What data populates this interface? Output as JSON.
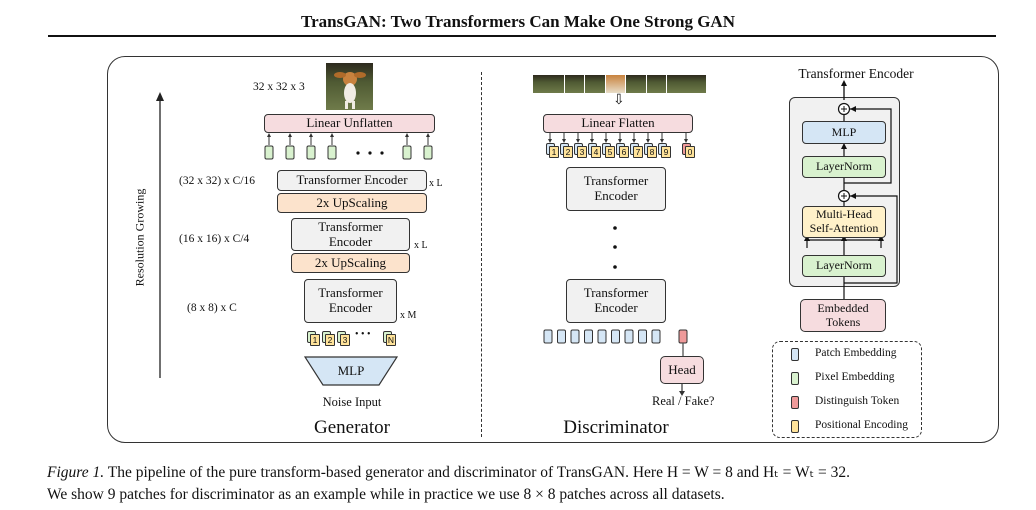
{
  "header": {
    "title": "TransGAN: Two Transformers Can Make One Strong GAN"
  },
  "generator": {
    "section_label": "Generator",
    "axis_label": "Resolution Growing",
    "output_size_label": "32 x 32 x 3",
    "output_image": "dog-image",
    "linear_unflatten": "Linear Unflatten",
    "stage1": {
      "size_label": "(32 x 32) x C/16",
      "encoder": "Transformer Encoder",
      "repeat": "x L",
      "upscaling": "2x UpScaling"
    },
    "stage2": {
      "size_label": "(16 x 16) x C/4",
      "encoder_line1": "Transformer",
      "encoder_line2": "Encoder",
      "repeat": "x L",
      "upscaling": "2x UpScaling"
    },
    "stage3": {
      "size_label": "(8 x 8) x C",
      "encoder_line1": "Transformer",
      "encoder_line2": "Encoder",
      "repeat": "x M"
    },
    "input_tokens": [
      "1",
      "2",
      "3",
      "N"
    ],
    "ellipsis": "• • •",
    "mlp": "MLP",
    "noise_input": "Noise Input"
  },
  "discriminator": {
    "section_label": "Discriminator",
    "patches_image": "dog-image-patches",
    "linear_flatten": "Linear Flatten",
    "tokens": [
      "1",
      "2",
      "3",
      "4",
      "5",
      "6",
      "7",
      "8",
      "9",
      "0"
    ],
    "encoder_top_line1": "Transformer",
    "encoder_top_line2": "Encoder",
    "encoder_bottom_line1": "Transformer",
    "encoder_bottom_line2": "Encoder",
    "head": "Head",
    "output_label": "Real / Fake?"
  },
  "encoder_detail": {
    "title": "Transformer Encoder",
    "mlp": "MLP",
    "layernorm_top": "LayerNorm",
    "mhsa_line1": "Multi-Head",
    "mhsa_line2": "Self-Attention",
    "layernorm_bottom": "LayerNorm",
    "embedded_line1": "Embedded",
    "embedded_line2": "Tokens"
  },
  "legend": {
    "items": [
      {
        "label": "Patch Embedding",
        "color": "#d5e6f5"
      },
      {
        "label": "Pixel Embedding",
        "color": "#d9f2cf"
      },
      {
        "label": "Distinguish Token",
        "color": "#ef9a9a"
      },
      {
        "label": "Positional Encoding",
        "color": "#ffe39a"
      }
    ]
  },
  "caption": {
    "figure_label": "Figure 1.",
    "line1": " The pipeline of the pure transform-based generator and discriminator of TransGAN. Here H = W = 8 and Hₜ = Wₜ = 32.",
    "line2": "We show 9 patches for discriminator as an example while in practice we use 8 × 8 patches across all datasets."
  }
}
